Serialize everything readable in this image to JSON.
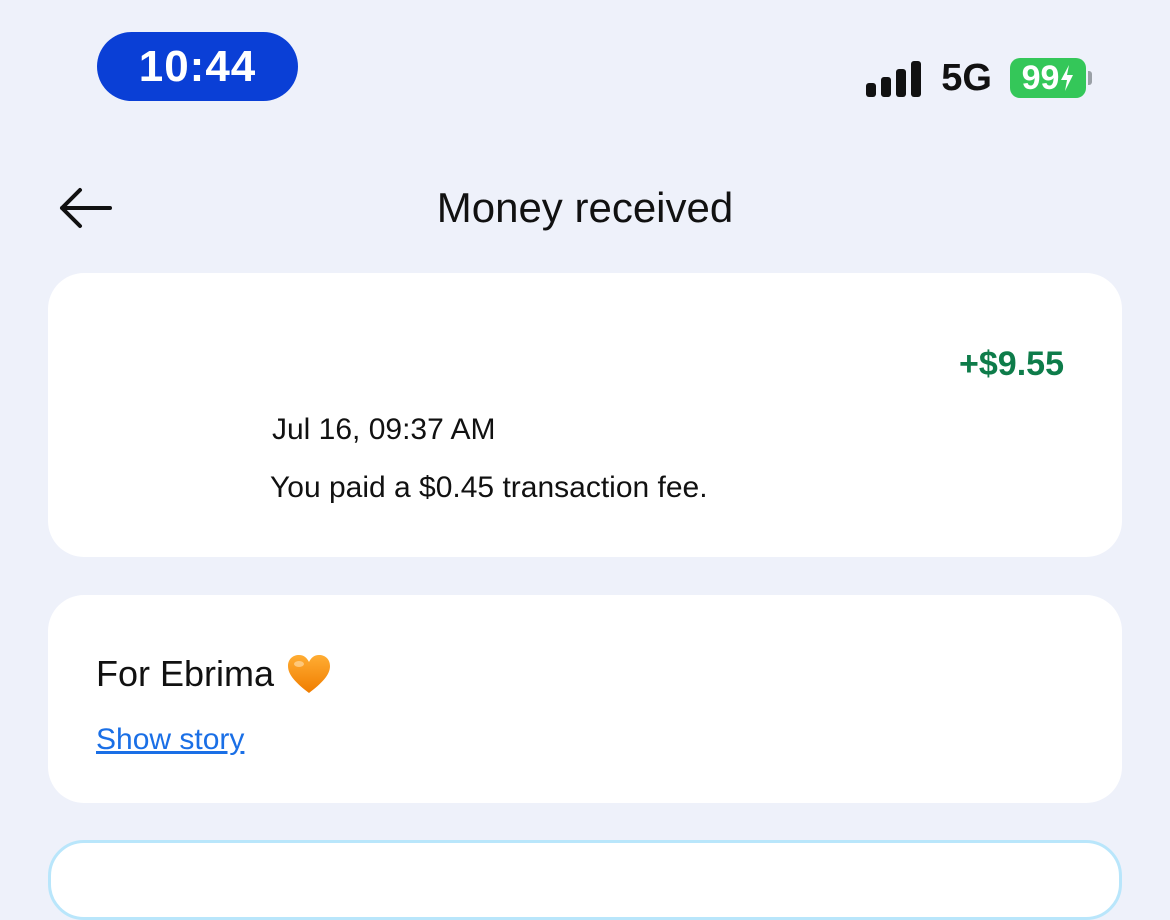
{
  "status_bar": {
    "time": "10:44",
    "network": "5G",
    "battery": "99",
    "signal_icon": "cellular-signal-icon",
    "battery_icon": "battery-charging-icon"
  },
  "header": {
    "title": "Money received",
    "back_icon": "arrow-left-icon"
  },
  "transaction": {
    "amount": "+$9.55",
    "datetime": "Jul 16, 09:37 AM",
    "fee_text": "You paid a $0.45 transaction fee."
  },
  "story": {
    "title": "For Ebrima",
    "emoji_icon": "orange-heart-icon",
    "link_label": "Show story"
  },
  "colors": {
    "time_pill": "#0a3fd6",
    "amount_green": "#0e7c4a",
    "link_blue": "#1a6fe6",
    "battery_green": "#34c759",
    "background": "#eef1fa"
  }
}
